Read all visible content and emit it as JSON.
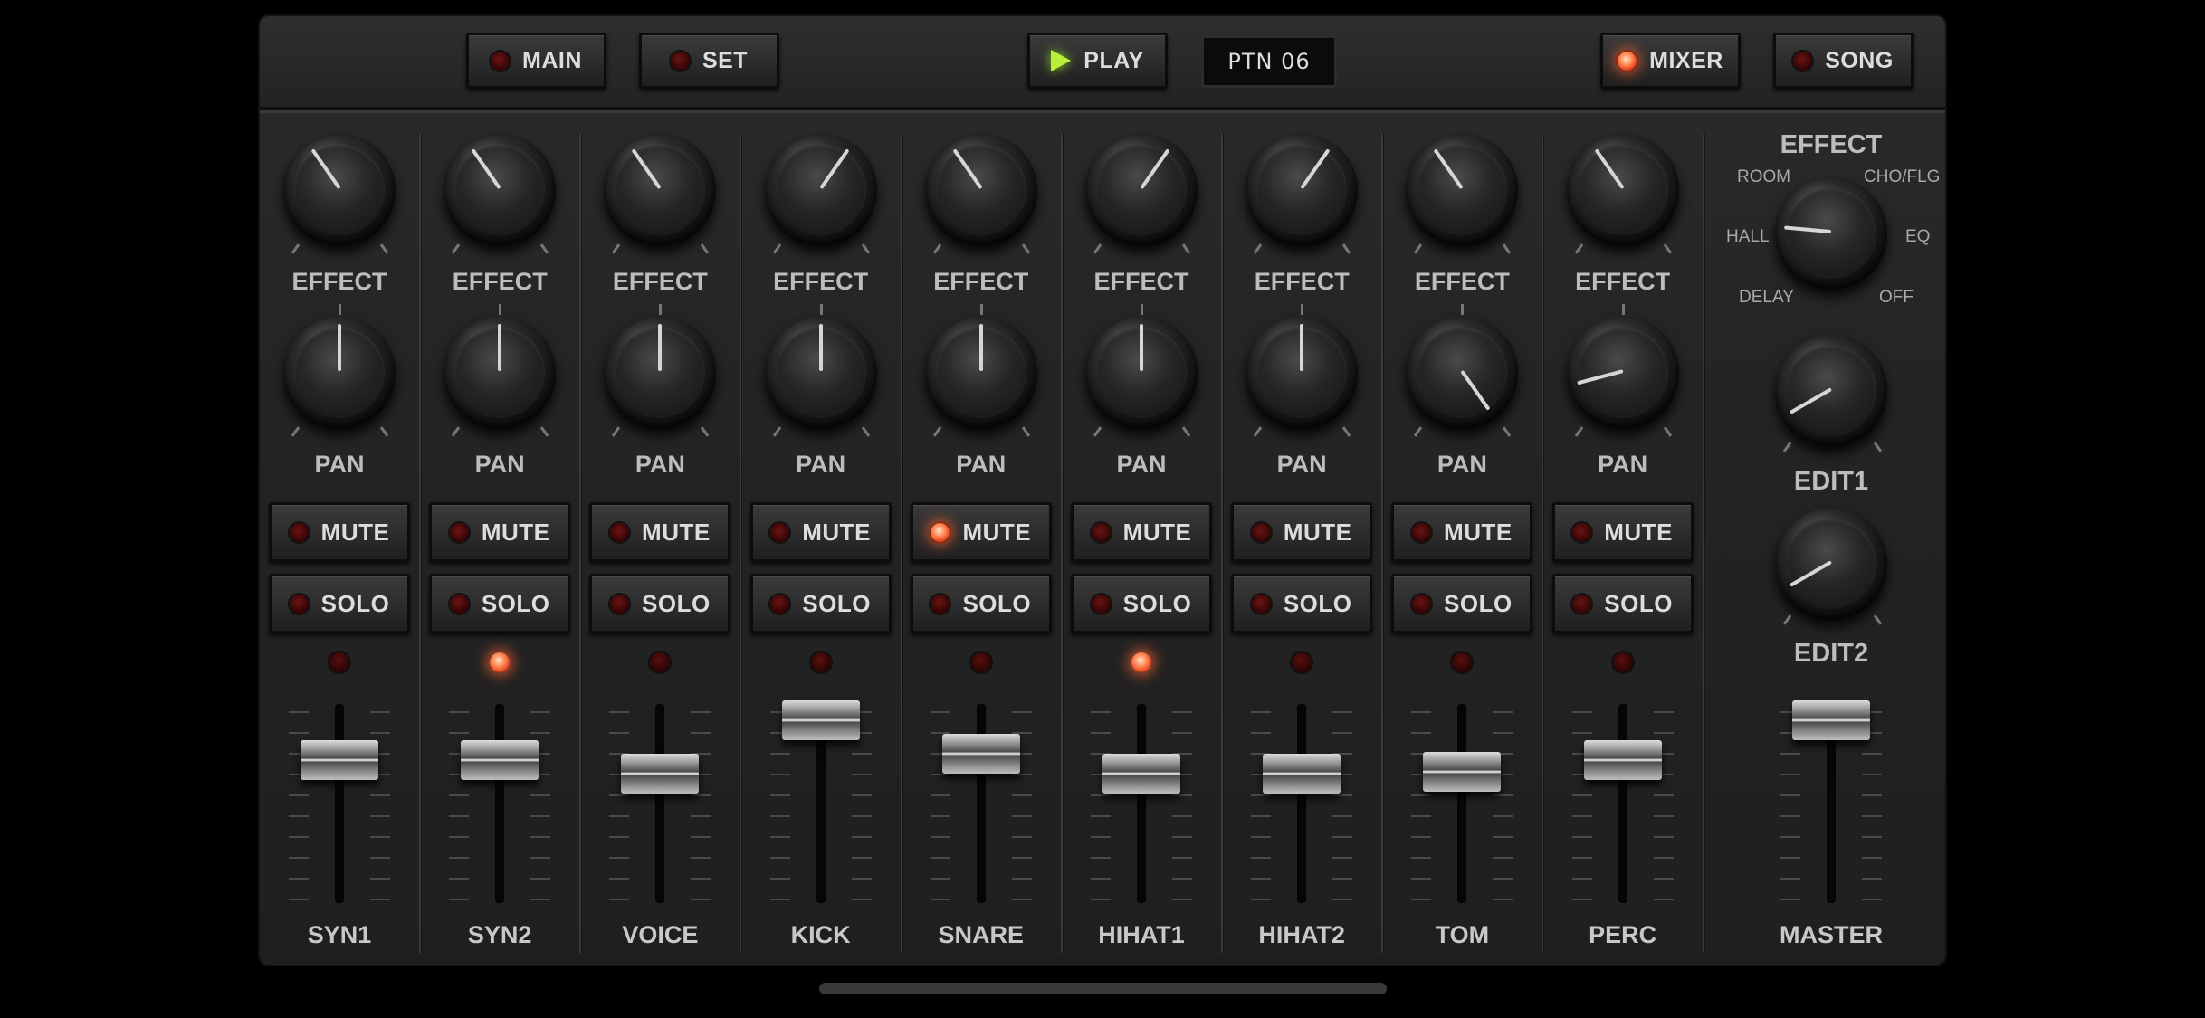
{
  "top": {
    "main": {
      "label": "MAIN",
      "on": false
    },
    "set": {
      "label": "SET",
      "on": false
    },
    "play": {
      "label": "PLAY"
    },
    "pattern": "PTN 06",
    "mixer": {
      "label": "MIXER",
      "on": true
    },
    "song": {
      "label": "SONG",
      "on": false
    }
  },
  "labels": {
    "effect": "EFFECT",
    "pan": "PAN",
    "mute": "MUTE",
    "solo": "SOLO"
  },
  "channels": [
    {
      "name": "SYN1",
      "effect_angle": -35,
      "pan_angle": 0,
      "mute": false,
      "solo": false,
      "indicator": false,
      "fader": 0.72
    },
    {
      "name": "SYN2",
      "effect_angle": -35,
      "pan_angle": 0,
      "mute": false,
      "solo": false,
      "indicator": true,
      "fader": 0.72
    },
    {
      "name": "VOICE",
      "effect_angle": -35,
      "pan_angle": 0,
      "mute": false,
      "solo": false,
      "indicator": false,
      "fader": 0.65
    },
    {
      "name": "KICK",
      "effect_angle": 35,
      "pan_angle": 0,
      "mute": false,
      "solo": false,
      "indicator": false,
      "fader": 0.92
    },
    {
      "name": "SNARE",
      "effect_angle": -35,
      "pan_angle": 0,
      "mute": true,
      "solo": false,
      "indicator": false,
      "fader": 0.75
    },
    {
      "name": "HIHAT1",
      "effect_angle": 35,
      "pan_angle": 0,
      "mute": false,
      "solo": false,
      "indicator": true,
      "fader": 0.65
    },
    {
      "name": "HIHAT2",
      "effect_angle": 35,
      "pan_angle": 0,
      "mute": false,
      "solo": false,
      "indicator": false,
      "fader": 0.65
    },
    {
      "name": "TOM",
      "effect_angle": -35,
      "pan_angle": 145,
      "mute": false,
      "solo": false,
      "indicator": false,
      "fader": 0.66
    },
    {
      "name": "PERC",
      "effect_angle": -35,
      "pan_angle": -105,
      "mute": false,
      "solo": false,
      "indicator": false,
      "fader": 0.72
    }
  ],
  "master": {
    "name": "MASTER",
    "effect_title": "EFFECT",
    "effect_options": {
      "room": "ROOM",
      "cho": "CHO/FLG",
      "hall": "HALL",
      "eq": "EQ",
      "delay": "DELAY",
      "off": "OFF"
    },
    "effect_selected": "HALL",
    "edit1": "EDIT1",
    "edit2": "EDIT2",
    "fader": 0.92
  }
}
